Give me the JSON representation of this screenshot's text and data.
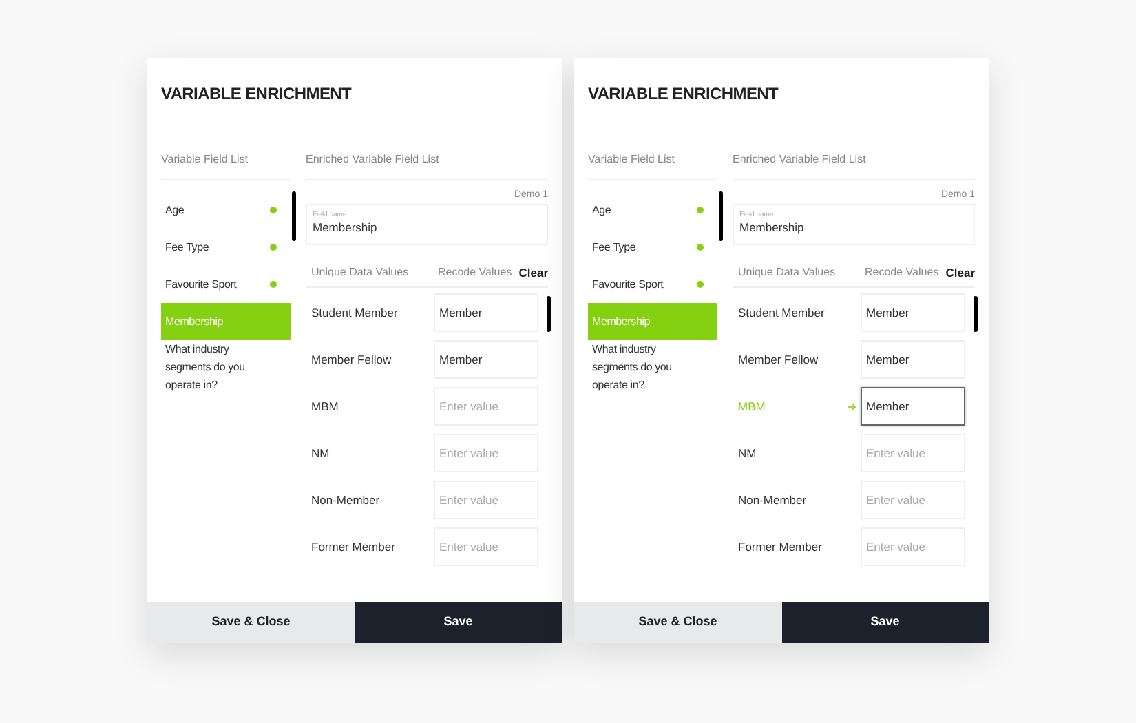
{
  "panels": [
    {
      "title": "VARIABLE ENRICHMENT",
      "left_heading": "Variable Field List",
      "right_heading": "Enriched Variable Field List",
      "fields": [
        {
          "label": "Age",
          "done": true,
          "selected": false
        },
        {
          "label": "Fee Type",
          "done": true,
          "selected": false
        },
        {
          "label": "Favourite Sport",
          "done": true,
          "selected": false
        },
        {
          "label": "Membership",
          "done": false,
          "selected": true
        },
        {
          "label": "What industry segments do you operate in?",
          "done": false,
          "selected": false
        }
      ],
      "demo": "Demo 1",
      "field_name": {
        "label": "Field name",
        "value": "Membership"
      },
      "columns": [
        "Unique Data Values",
        "Recode Values"
      ],
      "clear": "Clear",
      "rows": [
        {
          "value": "Student Member",
          "recode": "Member",
          "active": false
        },
        {
          "value": "Member Fellow",
          "recode": "Member",
          "active": false
        },
        {
          "value": "MBM",
          "placeholder": "Enter value",
          "active": false
        },
        {
          "value": "NM",
          "placeholder": "Enter value",
          "active": false
        },
        {
          "value": "Non-Member",
          "placeholder": "Enter value",
          "active": false
        },
        {
          "value": "Former Member",
          "placeholder": "Enter value",
          "active": false
        }
      ],
      "buttons": [
        "Save & Close",
        "Save"
      ]
    },
    {
      "title": "VARIABLE ENRICHMENT",
      "left_heading": "Variable Field List",
      "right_heading": "Enriched Variable Field List",
      "fields": [
        {
          "label": "Age",
          "done": true,
          "selected": false
        },
        {
          "label": "Fee Type",
          "done": true,
          "selected": false
        },
        {
          "label": "Favourite Sport",
          "done": true,
          "selected": false
        },
        {
          "label": "Membership",
          "done": false,
          "selected": true
        },
        {
          "label": "What industry segments do you operate in?",
          "done": false,
          "selected": false
        }
      ],
      "demo": "Demo 1",
      "field_name": {
        "label": "Field name",
        "value": "Membership"
      },
      "columns": [
        "Unique Data Values",
        "Recode Values"
      ],
      "clear": "Clear",
      "rows": [
        {
          "value": "Student Member",
          "recode": "Member",
          "active": false
        },
        {
          "value": "Member Fellow",
          "recode": "Member",
          "active": false
        },
        {
          "value": "MBM",
          "recode": "Member",
          "active": true
        },
        {
          "value": "NM",
          "placeholder": "Enter value",
          "active": false
        },
        {
          "value": "Non-Member",
          "placeholder": "Enter value",
          "active": false
        },
        {
          "value": "Former Member",
          "placeholder": "Enter value",
          "active": false
        }
      ],
      "buttons": [
        "Save & Close",
        "Save"
      ]
    }
  ]
}
